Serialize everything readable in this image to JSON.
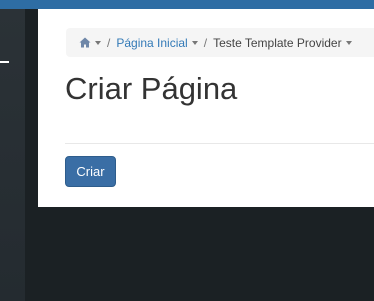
{
  "breadcrumb": {
    "home_icon": "home-icon",
    "items": [
      {
        "label": "Página Inicial"
      },
      {
        "label": "Teste Template Provider"
      }
    ],
    "separator": "/"
  },
  "page": {
    "title": "Criar Página"
  },
  "actions": {
    "create_label": "Criar"
  },
  "colors": {
    "topbar": "#2e6da4",
    "sidebar": "#2b3237",
    "button": "#3a6ea5",
    "link": "#337ab7"
  }
}
